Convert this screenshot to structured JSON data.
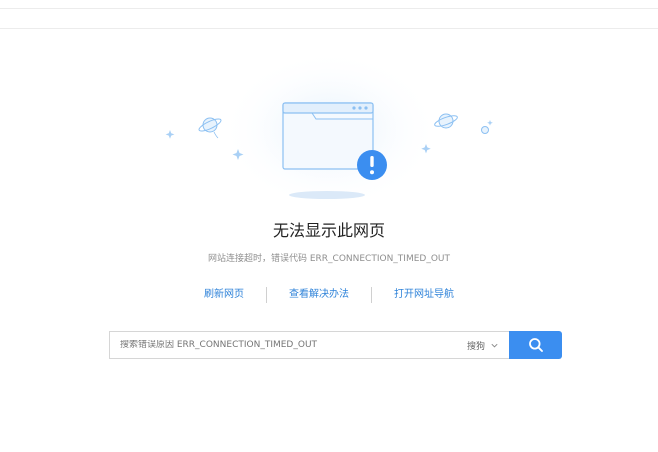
{
  "error": {
    "title": "无法显示此网页",
    "detail": "网站连接超时，错误代码 ERR_CONNECTION_TIMED_OUT"
  },
  "actions": [
    {
      "label": "刷新网页"
    },
    {
      "label": "查看解决办法"
    },
    {
      "label": "打开网址导航"
    }
  ],
  "search": {
    "placeholder": "搜索错误原因 ERR_CONNECTION_TIMED_OUT",
    "engine": "搜狗"
  },
  "colors": {
    "accent": "#3b8ef0",
    "link": "#2f83d9",
    "illustration_stroke": "#8cc0f2",
    "illustration_fill": "#e8f3fd"
  },
  "icons": {
    "browser_window": "browser-window-icon",
    "alert": "exclamation-badge-icon",
    "search": "search-icon",
    "chevron": "chevron-down-icon"
  }
}
